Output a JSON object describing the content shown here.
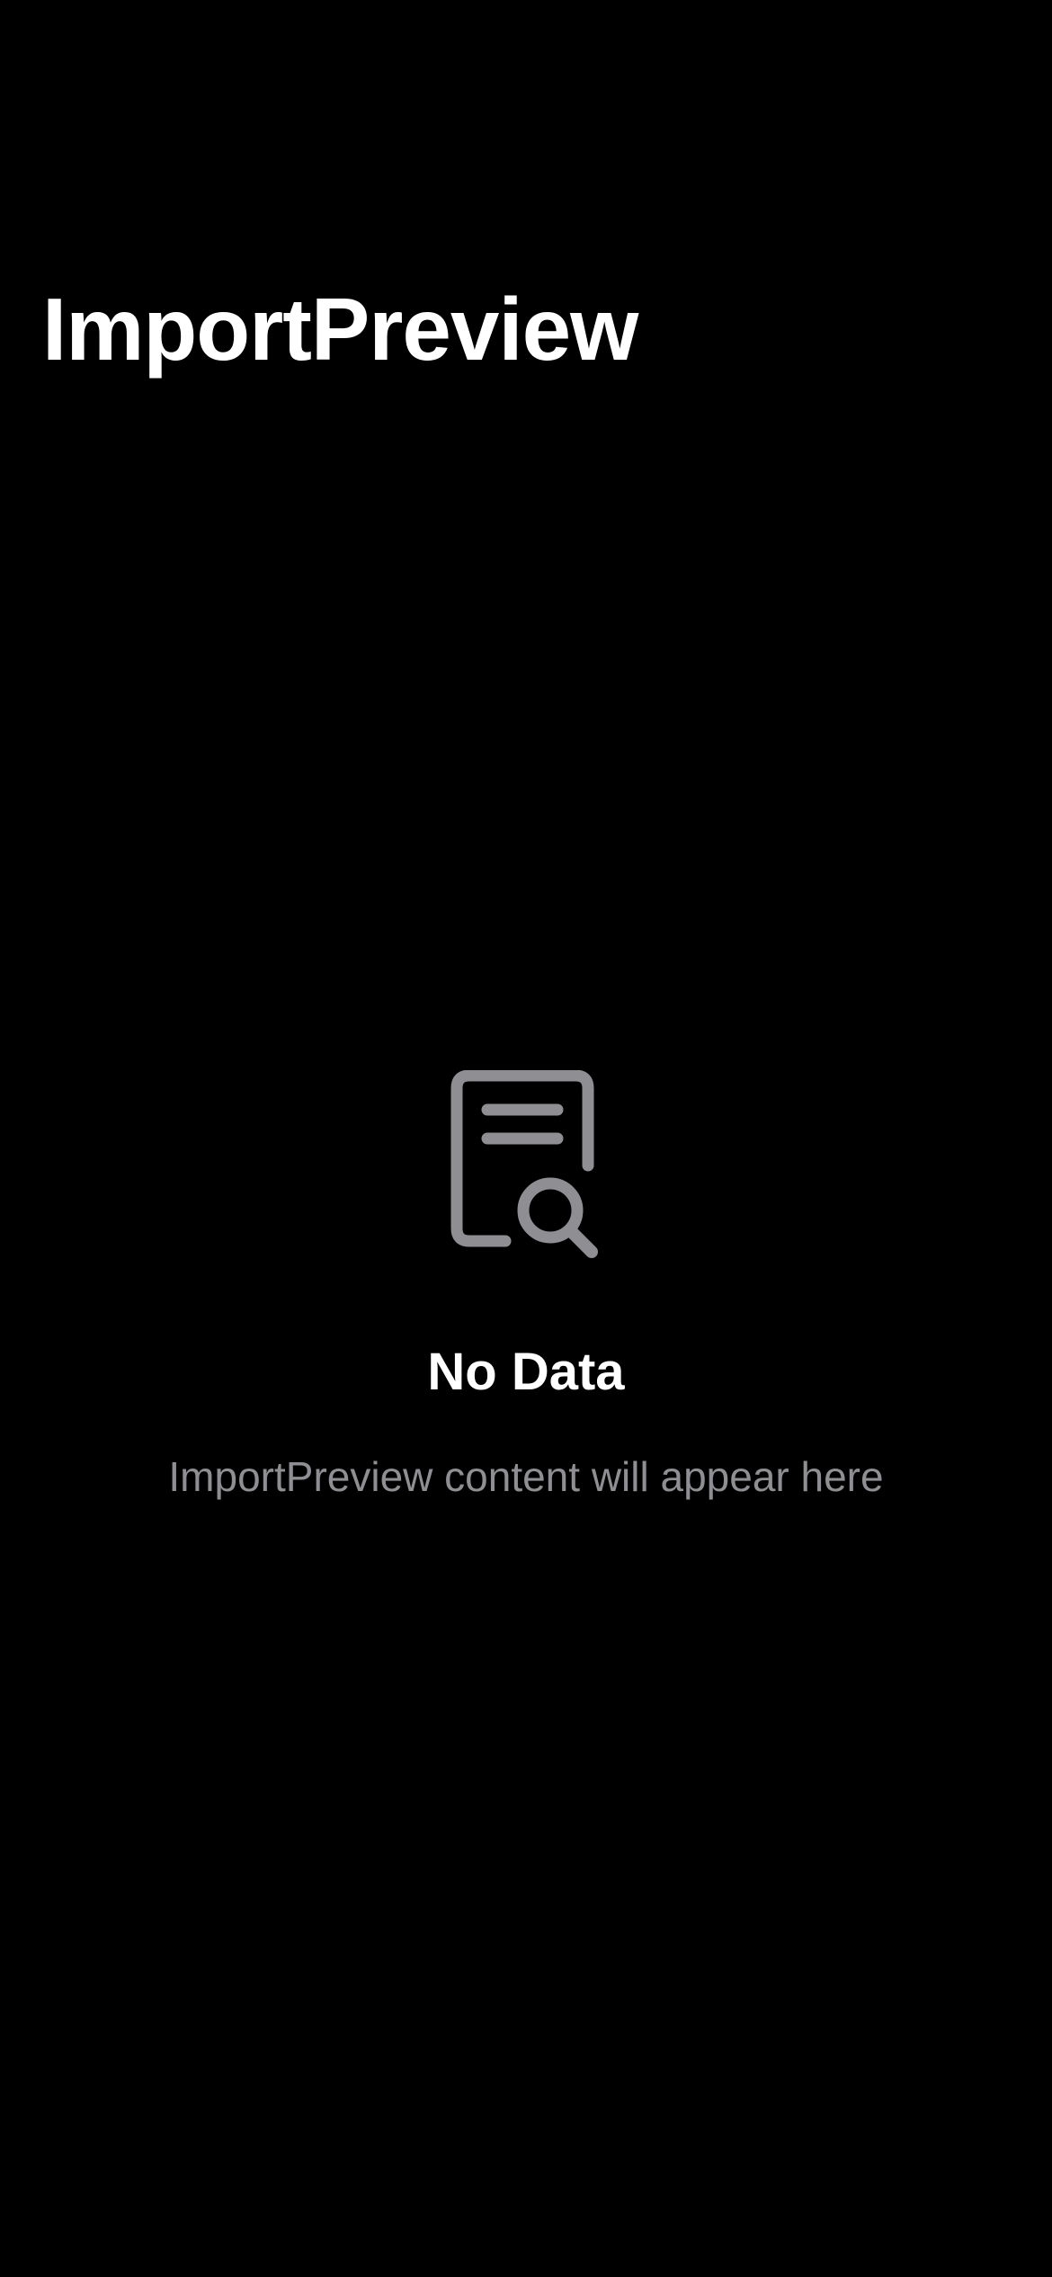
{
  "header": {
    "title": "ImportPreview"
  },
  "empty_state": {
    "icon": "doc-text-magnifyingglass-icon",
    "title": "No Data",
    "subtitle": "ImportPreview content will appear here"
  },
  "colors": {
    "background": "#000000",
    "primary_text": "#ffffff",
    "secondary_text": "#8e8e93",
    "icon": "#8e8e93"
  }
}
